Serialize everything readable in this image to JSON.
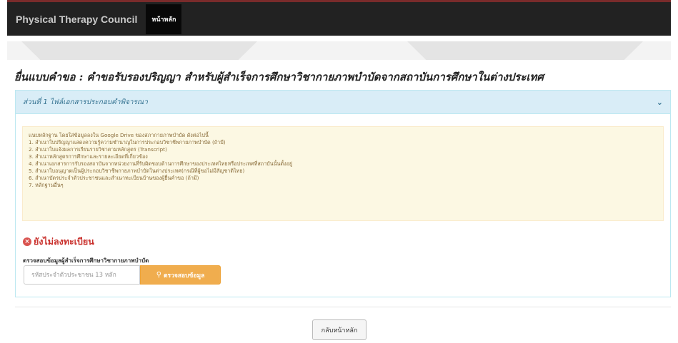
{
  "navbar": {
    "brand": "Physical Therapy Council",
    "home_label": "หน้าหลัก"
  },
  "page": {
    "title": "ยื่นแบบคำขอ : คำขอรับรองปริญญา สำหรับผู้สำเร็จการศึกษาวิชากายภาพบำบัดจากสถาบันการศึกษาในต่างประเทศ"
  },
  "panel": {
    "title": "ส่วนที่ 1 ไฟล์เอกสารประกอบคำพิจารณา",
    "chevron_icon": "chevron-down-icon",
    "alert_lines": [
      "แนบหลักฐาน โดยใส่ข้อมูลลงใน Google Drive ของสภากายภาพบำบัด ดังต่อไปนี้",
      "1. สำเนาใบปริญญาแสดงความรู้ความชำนาญในการประกอบวิชาชีพกายภาพบำบัด (ถ้ามี)",
      "2. สำเนาใบแจ้งผลการเรียนรายวิชาตามหลักสูตร (Transcript)",
      "3. สำเนาหลักสูตรการศึกษาและรายละเอียดที่เกี่ยวข้อง",
      "4. สำเนาเอกสารการรับรองสถาบันจากหน่วยงานที่รับผิดชอบด้านการศึกษาของประเทศไทยหรือประเทศที่สถาบันนั้นตั้งอยู่",
      "5. สำเนาใบอนุญาตเป็นผู้ประกอบวิชาชีพกายภาพบำบัดในต่างประเทศ(กรณีที่ผู้ขอไม่มีสัญชาติไทย)",
      "6. สำเนาบัตรประจำตัวประชาชนและสำเนาทะเบียนบ้านของผู้ยื่นคำขอ (ถ้ามี)",
      "7. หลักฐานอื่นๆ"
    ],
    "status_text": "ยังไม่ลงทะเบียน",
    "status_icon": "times-circle-icon",
    "check_label": "ตรวจสอบข้อมูลผู้สำเร็จการศึกษาวิชากายภาพบำบัด",
    "id_input_placeholder": "รหัสประจำตัวประชาชน 13 หลัก",
    "check_button_label": "ตรวจสอบข้อมูล",
    "check_button_icon": "search-icon"
  },
  "footer": {
    "back_button_label": "กลับหน้าหลัก"
  },
  "colors": {
    "navbar_bg": "#222222",
    "panel_heading_bg": "#d9edf7",
    "alert_bg": "#fcf8e3",
    "alert_text": "#8a6d3b",
    "status_red": "#c9302c",
    "check_button_bg": "#f0ad4e"
  }
}
